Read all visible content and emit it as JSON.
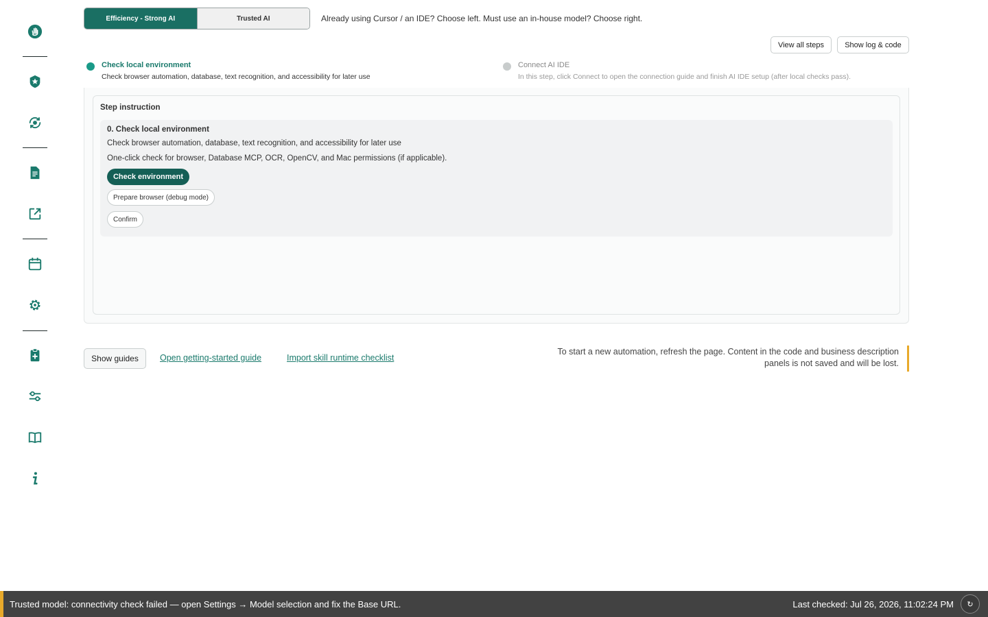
{
  "sidebar": {
    "items": [
      {
        "icon": "hand-icon"
      },
      {
        "icon": "star-badge-icon"
      },
      {
        "icon": "sync-gear-icon"
      },
      {
        "icon": "document-icon"
      },
      {
        "icon": "external-link-icon"
      },
      {
        "icon": "calendar-icon"
      },
      {
        "icon": "settings-gear-icon"
      },
      {
        "icon": "clipboard-plus-icon"
      },
      {
        "icon": "sliders-icon"
      },
      {
        "icon": "book-icon"
      },
      {
        "icon": "info-icon"
      }
    ],
    "accent": "#1a7a6c"
  },
  "mode": {
    "left_label": "Efficiency - Strong AI",
    "right_label": "Trusted AI",
    "selected": "left",
    "hint": "Already using Cursor / an IDE? Choose left. Must use an in-house model? Choose right."
  },
  "toolbar": {
    "view_all_steps": "View all steps",
    "show_log_code": "Show log & code"
  },
  "steps": [
    {
      "title": "Check local environment",
      "desc": "Check browser automation, database, text recognition, and accessibility for later use",
      "active": true
    },
    {
      "title": "Connect AI IDE",
      "desc": "In this step, click Connect to open the connection guide and finish AI IDE setup (after local checks pass).",
      "active": false
    }
  ],
  "instruction": {
    "heading": "Step instruction",
    "title": "0. Check local environment",
    "line1": "Check browser automation, database, text recognition, and accessibility for later use",
    "line2": "One-click check for browser, Database MCP, OCR, OpenCV, and Mac permissions (if applicable).",
    "check_button": "Check environment",
    "prepare_button": "Prepare browser (debug mode)",
    "confirm_button": "Confirm"
  },
  "footer": {
    "show_guides": "Show guides",
    "link_guide": "Open getting-started guide",
    "link_checklist": "Import skill runtime checklist",
    "notice": "To start a new automation, refresh the page. Content in the code and business description panels is not saved and will be lost."
  },
  "status": {
    "message": "Trusted model: connectivity check failed — open Settings → Model selection and fix the Base URL.",
    "last_checked": "Last checked: Jul 26, 2026, 11:02:24 PM",
    "refresh_glyph": "↻",
    "warning_color": "#e8a92a"
  }
}
